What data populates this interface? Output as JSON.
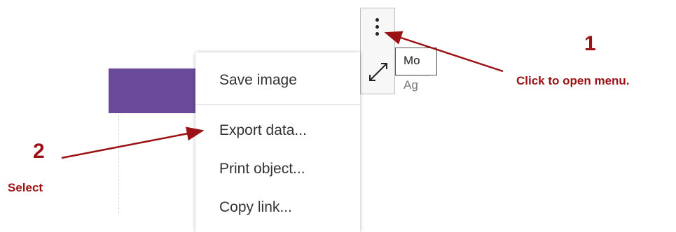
{
  "chart": {
    "bar_color": "#6b4a9c"
  },
  "toolbar": {
    "more_icon": "vertical-ellipsis-icon",
    "maximize_icon": "maximize-arrows-icon"
  },
  "hint": {
    "top_text": "Mo",
    "bottom_text": "Ag"
  },
  "menu": {
    "items": [
      {
        "label": "Save image"
      },
      {
        "label": "Export data..."
      },
      {
        "label": "Print object..."
      },
      {
        "label": "Copy link..."
      }
    ]
  },
  "annotations": {
    "step1": {
      "number": "1",
      "caption": "Click to open menu."
    },
    "step2": {
      "number": "2",
      "caption": "Select"
    },
    "color": "#9b1114"
  }
}
